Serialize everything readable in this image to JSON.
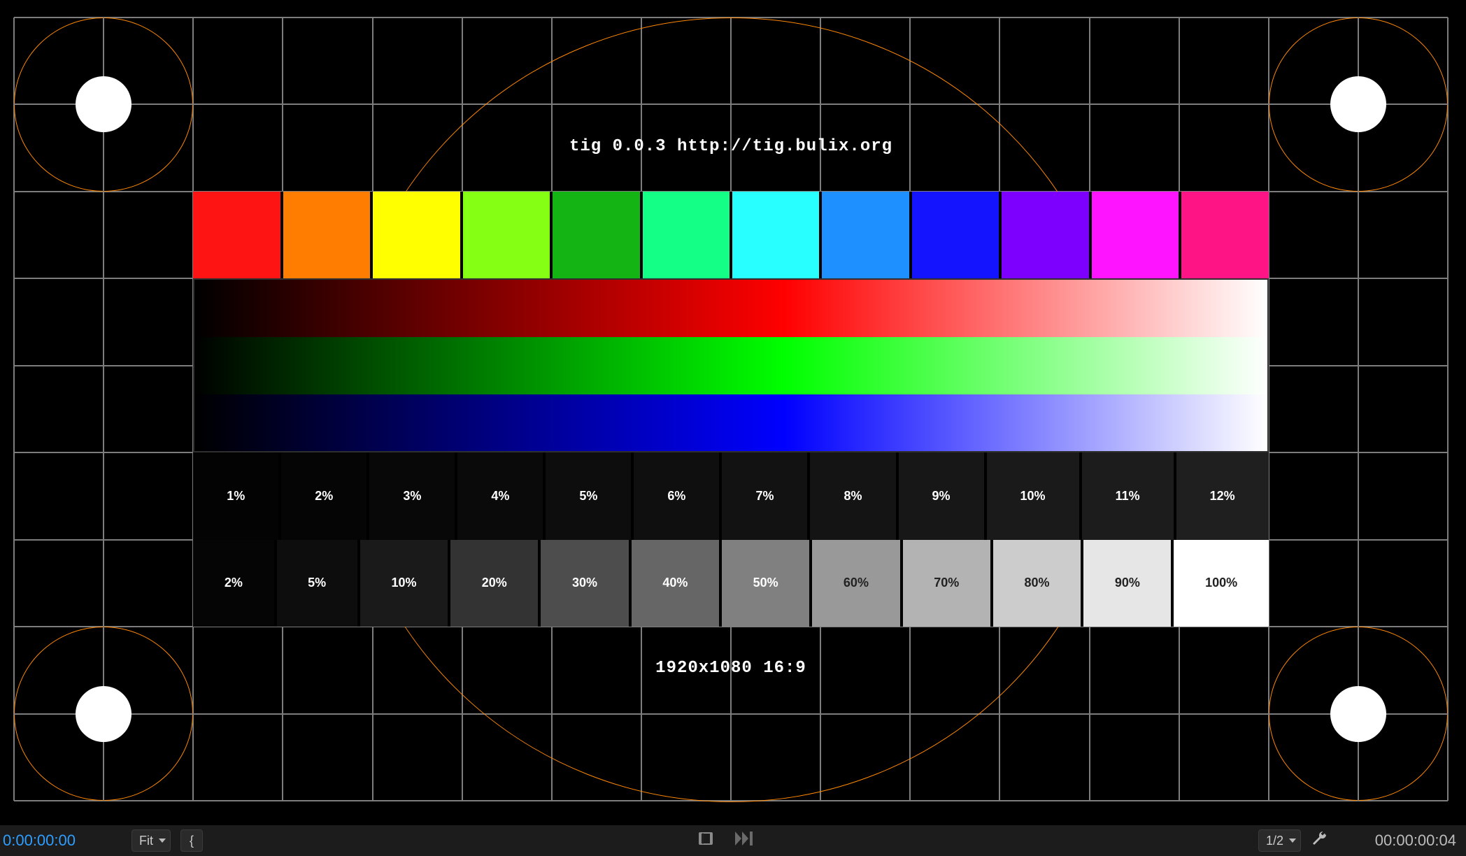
{
  "pattern": {
    "title_line": "tig 0.0.3  http://tig.bulix.org",
    "resolution_line": "1920x1080  16:9",
    "hue_colors": [
      "#ff1414",
      "#ff7d00",
      "#ffff00",
      "#85ff14",
      "#14b414",
      "#14ff85",
      "#28ffff",
      "#1e90ff",
      "#1414ff",
      "#7d00ff",
      "#ff14ff",
      "#ff1485"
    ],
    "near_black_steps": [
      {
        "label": "1%",
        "value": 1
      },
      {
        "label": "2%",
        "value": 2
      },
      {
        "label": "3%",
        "value": 3
      },
      {
        "label": "4%",
        "value": 4
      },
      {
        "label": "5%",
        "value": 5
      },
      {
        "label": "6%",
        "value": 6
      },
      {
        "label": "7%",
        "value": 7
      },
      {
        "label": "8%",
        "value": 8
      },
      {
        "label": "9%",
        "value": 9
      },
      {
        "label": "10%",
        "value": 10
      },
      {
        "label": "11%",
        "value": 11
      },
      {
        "label": "12%",
        "value": 12
      }
    ],
    "grey_ramp_steps": [
      {
        "label": "2%",
        "value": 2
      },
      {
        "label": "5%",
        "value": 5
      },
      {
        "label": "10%",
        "value": 10
      },
      {
        "label": "20%",
        "value": 20
      },
      {
        "label": "30%",
        "value": 30
      },
      {
        "label": "40%",
        "value": 40
      },
      {
        "label": "50%",
        "value": 50
      },
      {
        "label": "60%",
        "value": 60
      },
      {
        "label": "70%",
        "value": 70
      },
      {
        "label": "80%",
        "value": 80
      },
      {
        "label": "90%",
        "value": 90
      },
      {
        "label": "100%",
        "value": 100
      }
    ]
  },
  "toolbar": {
    "timecode_in": "0:00:00:00",
    "zoom_label": "Fit",
    "bracket_label": "{",
    "resolution_fraction_label": "1/2",
    "timecode_out": "00:00:00:04"
  }
}
